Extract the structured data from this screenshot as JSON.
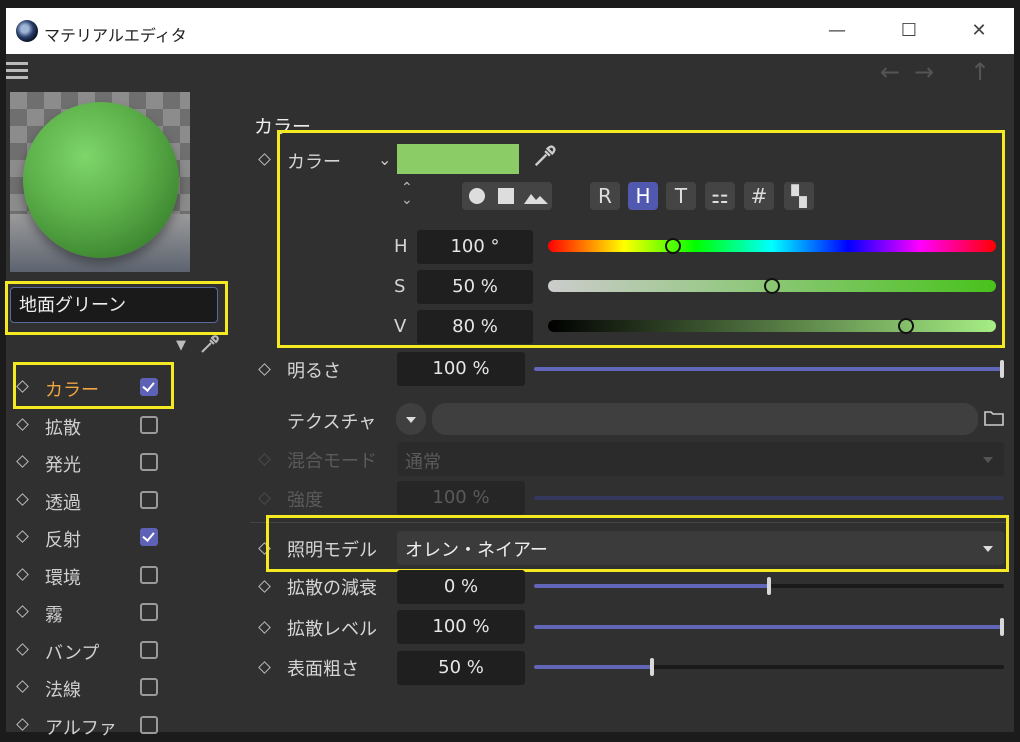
{
  "window": {
    "title": "マテリアルエディタ",
    "minimize": "—",
    "maximize": "☐",
    "close": "✕"
  },
  "toolbar": {
    "back": "←",
    "forward": "→",
    "up": "↑"
  },
  "material": {
    "name": "地面グリーン"
  },
  "channels": [
    {
      "label": "カラー",
      "checked": true,
      "active": true
    },
    {
      "label": "拡散",
      "checked": false
    },
    {
      "label": "発光",
      "checked": false
    },
    {
      "label": "透過",
      "checked": false
    },
    {
      "label": "反射",
      "checked": true
    },
    {
      "label": "環境",
      "checked": false
    },
    {
      "label": "霧",
      "checked": false
    },
    {
      "label": "バンプ",
      "checked": false
    },
    {
      "label": "法線",
      "checked": false
    },
    {
      "label": "アルファ",
      "checked": false
    }
  ],
  "section": {
    "title": "カラー"
  },
  "color": {
    "label": "カラー",
    "swatch": "#8ccc66",
    "modes": [
      "R",
      "H",
      "T",
      "⚏",
      "#",
      "▚"
    ],
    "selected_mode": "H",
    "h": {
      "label": "H",
      "value": "100 °",
      "fraction": 0.28
    },
    "s": {
      "label": "S",
      "value": "50 %",
      "fraction": 0.5
    },
    "v": {
      "label": "V",
      "value": "80 %",
      "fraction": 0.8
    }
  },
  "brightness": {
    "label": "明るさ",
    "value": "100 %",
    "fraction": 1.0
  },
  "texture": {
    "label": "テクスチャ"
  },
  "blend_mode": {
    "label": "混合モード",
    "value": "通常"
  },
  "strength": {
    "label": "強度",
    "value": "100 %",
    "fraction": 1.0
  },
  "illumination": {
    "label": "照明モデル",
    "value": "オレン・ネイアー"
  },
  "diffuse_falloff": {
    "label": "拡散の減衰",
    "value": "0 %",
    "fraction": 0.5
  },
  "diffuse_level": {
    "label": "拡散レベル",
    "value": "100 %",
    "fraction": 1.0
  },
  "roughness": {
    "label": "表面粗さ",
    "value": "50 %",
    "fraction": 0.25
  },
  "highlight_color": "#f5ea22",
  "accent_color": "#5e62b6"
}
